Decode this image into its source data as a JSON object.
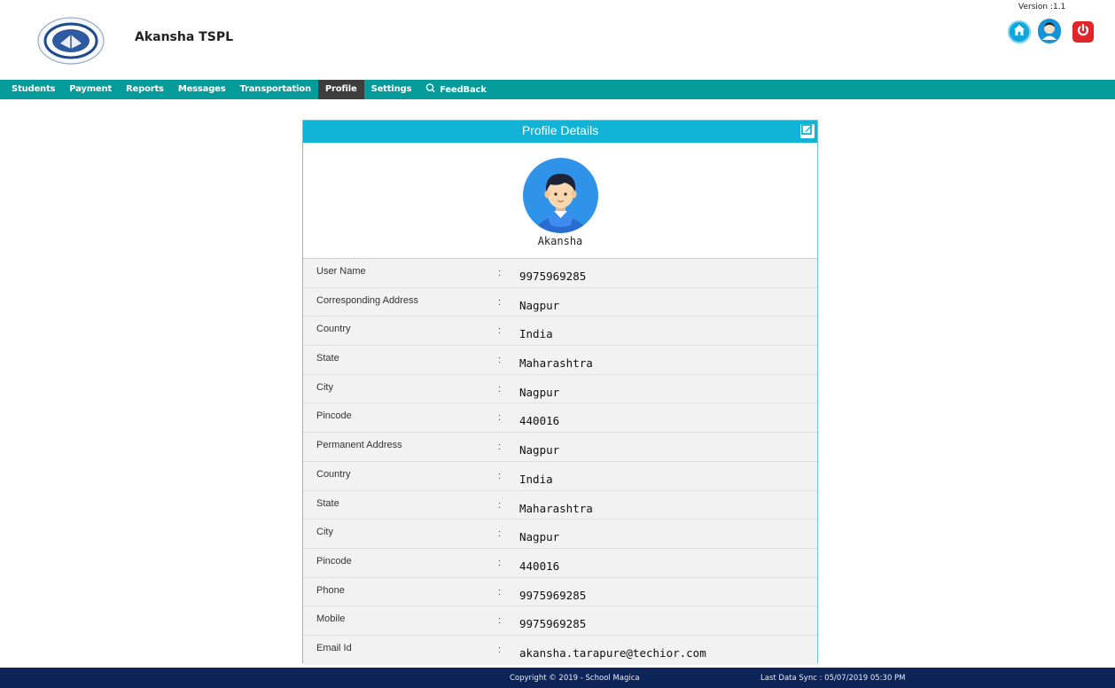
{
  "header": {
    "org_name": "Akansha TSPL",
    "version": "Version :1.1",
    "icons": {
      "home": "home-icon",
      "user": "user-icon",
      "power": "power-icon"
    }
  },
  "nav": {
    "items": [
      {
        "label": "Students"
      },
      {
        "label": "Payment"
      },
      {
        "label": "Reports"
      },
      {
        "label": "Messages"
      },
      {
        "label": "Transportation"
      },
      {
        "label": "Profile",
        "active": true
      },
      {
        "label": "Settings"
      },
      {
        "label": "FeedBack",
        "icon": "feedback-icon"
      }
    ]
  },
  "profile": {
    "title": "Profile Details",
    "name": "Akansha",
    "fields": [
      {
        "label": "User Name",
        "value": "9975969285"
      },
      {
        "label": "Corresponding Address",
        "value": "Nagpur"
      },
      {
        "label": "Country",
        "value": "India"
      },
      {
        "label": "State",
        "value": "Maharashtra"
      },
      {
        "label": "City",
        "value": "Nagpur"
      },
      {
        "label": "Pincode",
        "value": "440016"
      },
      {
        "label": "Permanent Address",
        "value": "Nagpur"
      },
      {
        "label": "Country",
        "value": "India"
      },
      {
        "label": "State",
        "value": "Maharashtra"
      },
      {
        "label": "City",
        "value": "Nagpur"
      },
      {
        "label": "Pincode",
        "value": "440016"
      },
      {
        "label": "Phone",
        "value": "9975969285"
      },
      {
        "label": "Mobile",
        "value": "9975969285"
      },
      {
        "label": "Email Id",
        "value": "akansha.tarapure@techior.com"
      }
    ]
  },
  "footer": {
    "copyright": "Copyright © 2019 - School Magica",
    "sync": "Last Data Sync : 05/07/2019 05:30 PM"
  },
  "colors": {
    "nav_bg": "#069b9b",
    "panel_header": "#11b4d6",
    "footer_bg": "#0c2457",
    "active_nav": "#3d3d3d"
  }
}
